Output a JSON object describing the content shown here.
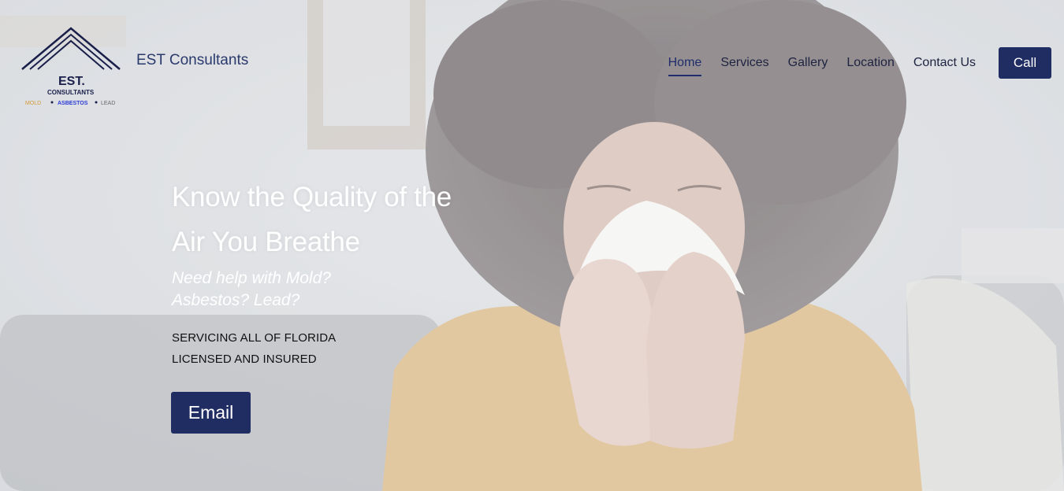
{
  "brand": {
    "name": "EST Consultants",
    "logo_text": "EST.",
    "logo_subtext": "CONSULTANTS",
    "logo_tagline": [
      "MOLD",
      "ASBESTOS",
      "LEAD"
    ]
  },
  "nav": {
    "items": [
      {
        "label": "Home",
        "active": true
      },
      {
        "label": "Services",
        "active": false
      },
      {
        "label": "Gallery",
        "active": false
      },
      {
        "label": "Location",
        "active": false
      },
      {
        "label": "Contact Us",
        "active": false
      }
    ],
    "call_label": "Call"
  },
  "hero": {
    "headline": "Know the Quality of the Air You Breathe",
    "subhead": "Need help with Mold? Asbestos? Lead?",
    "info_lines": [
      "SERVICING ALL OF FLORIDA",
      "LICENSED AND INSURED"
    ],
    "email_label": "Email"
  },
  "colors": {
    "brand_navy": "#1f2d63",
    "nav_text": "#1d2340",
    "tagline_mold": "#d49a3a",
    "tagline_asbestos": "#2b3bd6",
    "tagline_lead": "#666666"
  }
}
